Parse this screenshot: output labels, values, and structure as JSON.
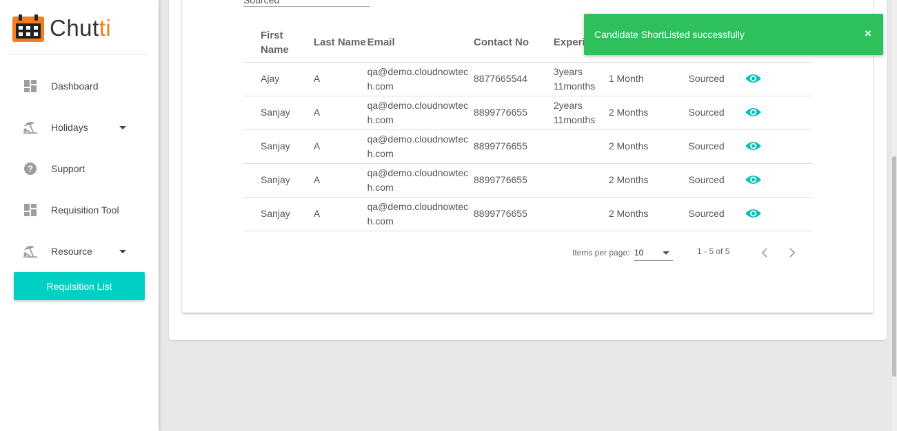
{
  "brand": {
    "name_main": "Chut",
    "name_accent": "ti",
    "accent_color": "#f47b20"
  },
  "sidebar": {
    "items": [
      {
        "label": "Dashboard",
        "icon": "dashboard-icon"
      },
      {
        "label": "Holidays",
        "icon": "beach-icon",
        "has_caret": true
      },
      {
        "label": "Support",
        "icon": "help-icon"
      },
      {
        "label": "Requisition Tool",
        "icon": "dashboard-icon"
      },
      {
        "label": "Resource",
        "icon": "beach-icon",
        "has_caret": true
      }
    ],
    "active_subitem": "Requisition List",
    "active_color": "#00cfc4"
  },
  "filter_field": {
    "value": "Sourced"
  },
  "table": {
    "headers": [
      "First Name",
      "Last Name",
      "Email",
      "Contact No",
      "Experience",
      "",
      "",
      ""
    ],
    "rows": [
      {
        "first": "Ajay",
        "last": "A",
        "email": "qa@demo.cloudnowtech.com",
        "contact": "8877665544",
        "experience": "3years 11months",
        "notice": "1 Month",
        "status": "Sourced"
      },
      {
        "first": "Sanjay",
        "last": "A",
        "email": "qa@demo.cloudnowtech.com",
        "contact": "8899776655",
        "experience": "2years 11months",
        "notice": "2 Months",
        "status": "Sourced"
      },
      {
        "first": "Sanjay",
        "last": "A",
        "email": "qa@demo.cloudnowtech.com",
        "contact": "8899776655",
        "experience": "",
        "notice": "2 Months",
        "status": "Sourced"
      },
      {
        "first": "Sanjay",
        "last": "A",
        "email": "qa@demo.cloudnowtech.com",
        "contact": "8899776655",
        "experience": "",
        "notice": "2 Months",
        "status": "Sourced"
      },
      {
        "first": "Sanjay",
        "last": "A",
        "email": "qa@demo.cloudnowtech.com",
        "contact": "8899776655",
        "experience": "",
        "notice": "2 Months",
        "status": "Sourced"
      }
    ],
    "action_icon": "eye-icon",
    "action_color": "#00c2b8"
  },
  "paginator": {
    "items_per_page_label": "Items per page:",
    "page_size": "10",
    "range_label": "1 - 5 of 5"
  },
  "toast": {
    "message": "Candidate ShortListed successfully",
    "close_label": "×",
    "color": "#2ec05a"
  }
}
